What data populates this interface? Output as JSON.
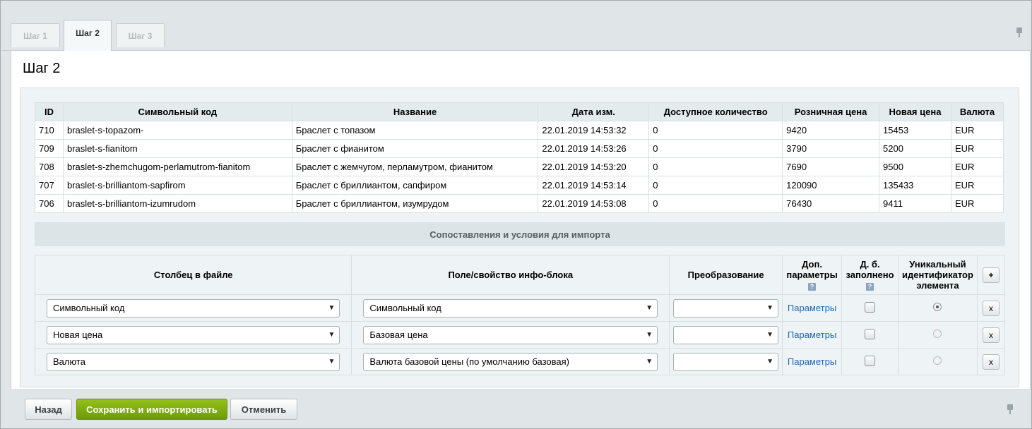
{
  "tabs": [
    {
      "label": "Шаг 1"
    },
    {
      "label": "Шаг 2"
    },
    {
      "label": "Шаг 3"
    }
  ],
  "page_title": "Шаг 2",
  "preview": {
    "headers": [
      "ID",
      "Символьный код",
      "Название",
      "Дата изм.",
      "Доступное количество",
      "Розничная цена",
      "Новая цена",
      "Валюта"
    ],
    "rows": [
      [
        "710",
        "braslet-s-topazom-",
        "Браслет с топазом",
        "22.01.2019 14:53:32",
        "0",
        "9420",
        "15453",
        "EUR"
      ],
      [
        "709",
        "braslet-s-fianitom",
        "Браслет с фианитом",
        "22.01.2019 14:53:26",
        "0",
        "3790",
        "5200",
        "EUR"
      ],
      [
        "708",
        "braslet-s-zhemchugom-perlamutrom-fianitom",
        "Браслет с жемчугом, перламутром, фианитом",
        "22.01.2019 14:53:20",
        "0",
        "7690",
        "9500",
        "EUR"
      ],
      [
        "707",
        "braslet-s-brilliantom-sapfirom",
        "Браслет с бриллиантом, сапфиром",
        "22.01.2019 14:53:14",
        "0",
        "120090",
        "135433",
        "EUR"
      ],
      [
        "706",
        "braslet-s-brilliantom-izumrudom",
        "Браслет с бриллиантом, изумрудом",
        "22.01.2019 14:53:08",
        "0",
        "76430",
        "9411",
        "EUR"
      ]
    ]
  },
  "section_title": "Сопоставления и условия для импорта",
  "mapping": {
    "headers": {
      "column": "Столбец в файле",
      "field": "Поле/свойство инфо-блока",
      "transform": "Преобразование",
      "extra_line1": "Доп.",
      "extra_line2": "параметры",
      "required_line1": "Д. б.",
      "required_line2": "заполнено",
      "unique_line1": "Уникальный",
      "unique_line2": "идентификатор",
      "unique_line3": "элемента",
      "help": "?",
      "add": "+"
    },
    "rows": [
      {
        "column": "Символьный код",
        "field": "Символьный код",
        "transform": "",
        "params": "Параметры",
        "required": false,
        "unique": true,
        "remove": "x"
      },
      {
        "column": "Новая цена",
        "field": "Базовая цена",
        "transform": "",
        "params": "Параметры",
        "required": false,
        "unique": false,
        "remove": "x"
      },
      {
        "column": "Валюта",
        "field": "Валюта базовой цены (по умолчанию базовая)",
        "transform": "",
        "params": "Параметры",
        "required": false,
        "unique": false,
        "remove": "x"
      }
    ]
  },
  "footer": {
    "back": "Назад",
    "save": "Сохранить и импортировать",
    "cancel": "Отменить"
  },
  "colors": {
    "primary_button": "#7aa80e",
    "link": "#2267b3",
    "background": "#e0e6e8"
  },
  "icons": [
    "pin-icon",
    "help-icon",
    "dropdown-arrow-icon"
  ]
}
